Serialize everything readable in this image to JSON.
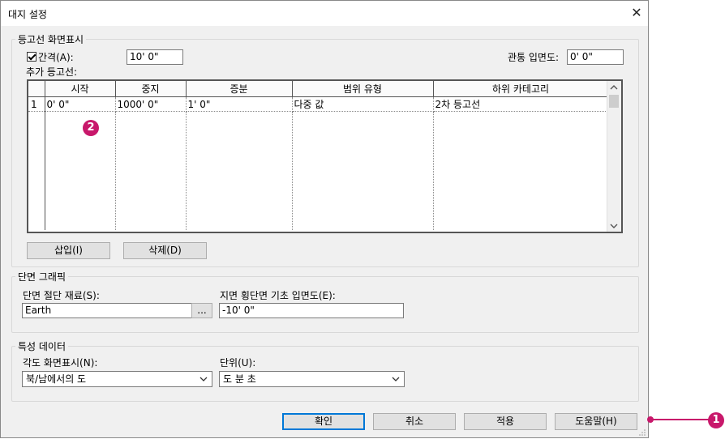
{
  "window": {
    "title": "대지 설정"
  },
  "contour_group": {
    "label": "등고선 화면표시",
    "interval_checkbox_label": "간격(A):",
    "interval_checked": true,
    "interval_value": "10'  0\"",
    "pass_through_label": "관통 입면도:",
    "pass_through_value": "0'  0\"",
    "additional_label": "추가 등고선:",
    "table": {
      "columns": [
        "시작",
        "중지",
        "증분",
        "범위 유형",
        "하위 카테고리"
      ],
      "rows": [
        {
          "num": "1",
          "start": "0'  0\"",
          "stop": "1000'  0\"",
          "increment": "1'  0\"",
          "range_type": "다중 값",
          "subcategory": "2차 등고선"
        }
      ]
    },
    "insert_button": "삽입(I)",
    "delete_button": "삭제(D)"
  },
  "section_group": {
    "label": "단면 그래픽",
    "cut_material_label": "단면 절단 재료(S):",
    "cut_material_value": "Earth",
    "browse_button": "...",
    "base_elevation_label": "지면 횡단면 기초 입면도(E):",
    "base_elevation_value": "-10'  0\""
  },
  "property_group": {
    "label": "특성 데이터",
    "angle_label": "각도 화면표시(N):",
    "angle_value": "북/남에서의 도",
    "units_label": "단위(U):",
    "units_value": "도 분 초"
  },
  "footer": {
    "ok": "확인",
    "cancel": "취소",
    "apply": "적용",
    "help": "도움말(H)"
  },
  "annotations": {
    "badge1": "1",
    "badge2": "2",
    "color": "#c8186b"
  }
}
